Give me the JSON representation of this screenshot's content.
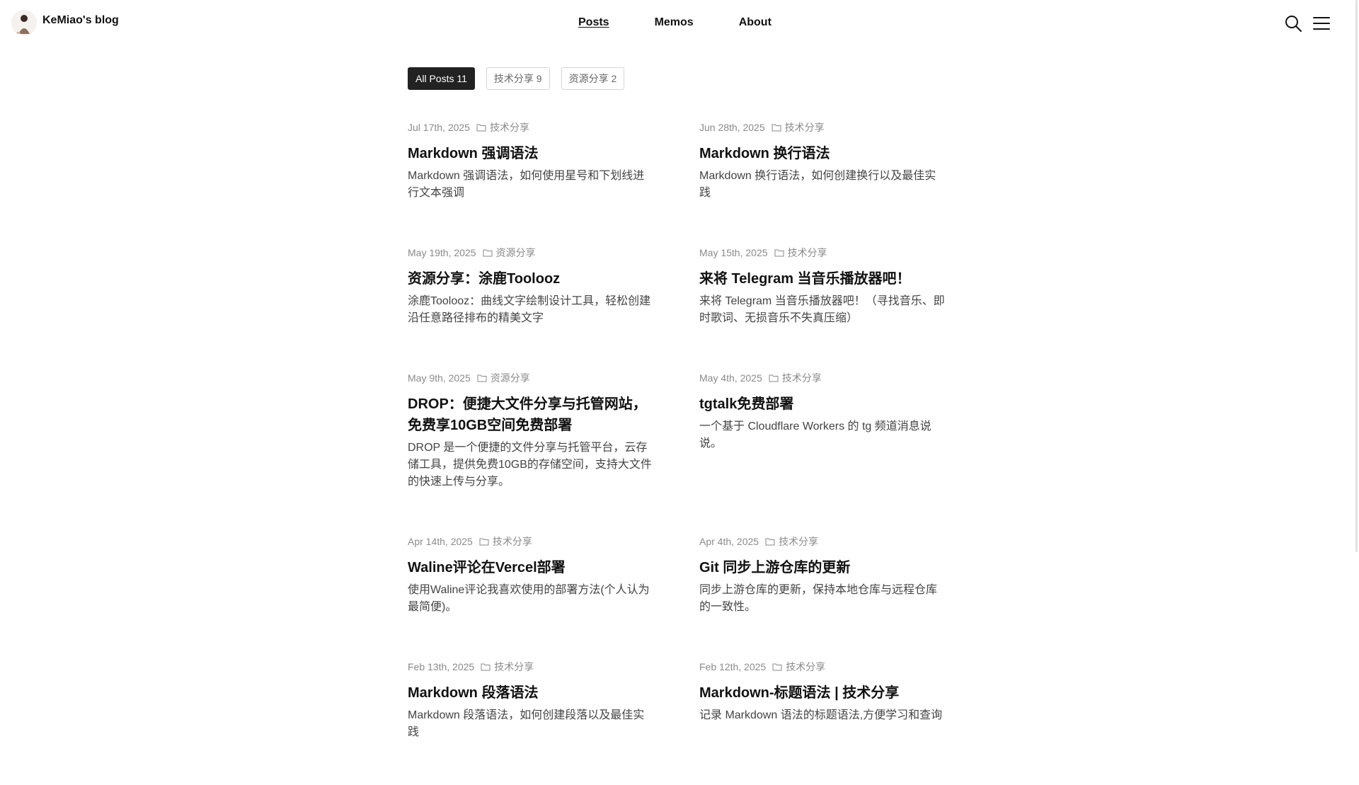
{
  "header": {
    "brand_name": "KeMiao's blog",
    "nav": [
      {
        "label": "Posts",
        "active": true
      },
      {
        "label": "Memos",
        "active": false
      },
      {
        "label": "About",
        "active": false
      }
    ],
    "icons": [
      "search-icon",
      "menu-icon"
    ]
  },
  "filters": [
    {
      "label": "All Posts 11",
      "active": true
    },
    {
      "label": "技术分享 9",
      "active": false
    },
    {
      "label": "资源分享 2",
      "active": false
    }
  ],
  "posts": [
    {
      "date": "Jul 17th, 2025",
      "category": "技术分享",
      "title": "Markdown 强调语法",
      "desc": "Markdown 强调语法，如何使用星号和下划线进行文本强调"
    },
    {
      "date": "Jun 28th, 2025",
      "category": "技术分享",
      "title": "Markdown 换行语法",
      "desc": "Markdown 换行语法，如何创建换行以及最佳实践"
    },
    {
      "date": "May 19th, 2025",
      "category": "资源分享",
      "title": "资源分享：涂鹿Toolooz",
      "desc": "涂鹿Toolooz：曲线文字绘制设计工具，轻松创建沿任意路径排布的精美文字"
    },
    {
      "date": "May 15th, 2025",
      "category": "技术分享",
      "title": "来将 Telegram 当音乐播放器吧！",
      "desc": "来将 Telegram 当音乐播放器吧！（寻找音乐、即时歌词、无损音乐不失真压缩）"
    },
    {
      "date": "May 9th, 2025",
      "category": "资源分享",
      "title": "DROP：便捷大文件分享与托管网站，免费享10GB空间免费部署",
      "desc": "DROP 是一个便捷的文件分享与托管平台，云存储工具，提供免费10GB的存储空间，支持大文件的快速上传与分享。"
    },
    {
      "date": "May 4th, 2025",
      "category": "技术分享",
      "title": "tgtalk免费部署",
      "desc": "一个基于 Cloudflare Workers 的 tg 频道消息说说。"
    },
    {
      "date": "Apr 14th, 2025",
      "category": "技术分享",
      "title": "Waline评论在Vercel部署",
      "desc": "使用Waline评论我喜欢使用的部署方法(个人认为最简便)。"
    },
    {
      "date": "Apr 4th, 2025",
      "category": "技术分享",
      "title": "Git 同步上游仓库的更新",
      "desc": "同步上游仓库的更新，保持本地仓库与远程仓库的一致性。"
    },
    {
      "date": "Feb 13th, 2025",
      "category": "技术分享",
      "title": "Markdown 段落语法",
      "desc": "Markdown 段落语法，如何创建段落以及最佳实践"
    },
    {
      "date": "Feb 12th, 2025",
      "category": "技术分享",
      "title": "Markdown-标题语法 | 技术分享",
      "desc": "记录 Markdown 语法的标题语法,方便学习和查询"
    }
  ]
}
